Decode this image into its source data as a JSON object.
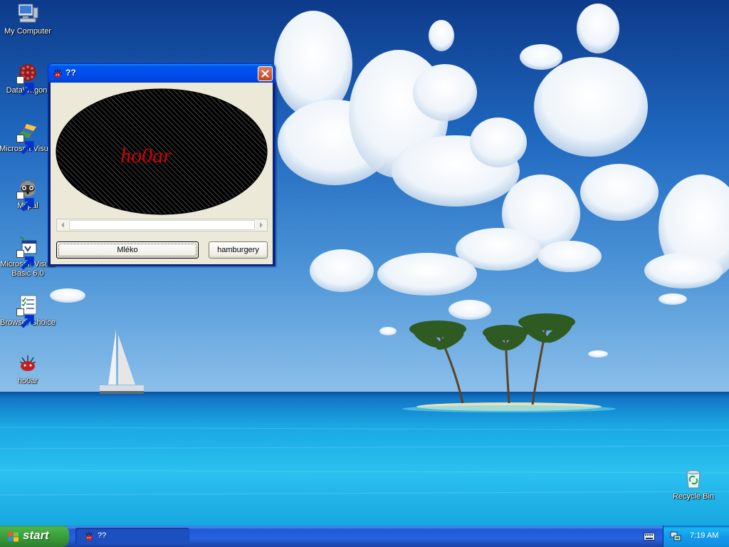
{
  "desktop": {
    "icons": [
      {
        "label": "My Computer"
      },
      {
        "label": "DataWagon."
      },
      {
        "label": "Microsoft Visual C++ 6.0"
      },
      {
        "label": "Mypal"
      },
      {
        "label": "Microsoft Visual Basic 6.0"
      },
      {
        "label": "Browser Choice"
      },
      {
        "label": "ho0ar"
      },
      {
        "label": "Recycle Bin"
      }
    ]
  },
  "window": {
    "title": "??",
    "ellipse_text": "ho0ar",
    "buttons": {
      "mleko": "Mléko",
      "hamburgery": "hamburgery"
    }
  },
  "taskbar": {
    "start_label": "start",
    "task_label": "??",
    "clock": "7:19 AM"
  },
  "colors": {
    "title_bar": "#0054e3",
    "client": "#ece9d8",
    "ellipse_text": "#d40000",
    "taskbar": "#245edb",
    "start_green": "#3c9a3c"
  }
}
